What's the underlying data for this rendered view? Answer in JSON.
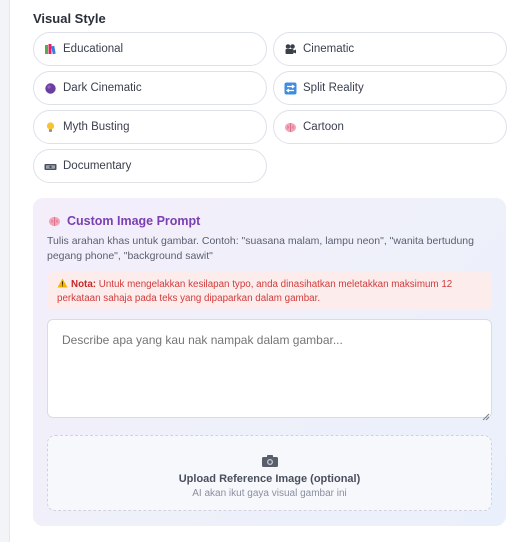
{
  "visual_style": {
    "title": "Visual Style",
    "options": [
      {
        "label": "Educational",
        "icon": "books-icon"
      },
      {
        "label": "Cinematic",
        "icon": "film-camera-icon"
      },
      {
        "label": "Dark Cinematic",
        "icon": "purple-circle-icon"
      },
      {
        "label": "Split Reality",
        "icon": "split-icon"
      },
      {
        "label": "Myth Busting",
        "icon": "lightbulb-icon"
      },
      {
        "label": "Cartoon",
        "icon": "brain-icon"
      },
      {
        "label": "Documentary",
        "icon": "video-camera-icon"
      }
    ]
  },
  "custom_prompt": {
    "title": "Custom Image Prompt",
    "description": "Tulis arahan khas untuk gambar. Contoh: \"suasana malam, lampu neon\", \"wanita bertudung pegang phone\", \"background sawit\"",
    "note_label": "Nota:",
    "note_text": "Untuk mengelakkan kesilapan typo, anda dinasihatkan meletakkan maksimum 12 perkataan sahaja pada teks yang dipaparkan dalam gambar.",
    "textarea_placeholder": "Describe apa yang kau nak nampak dalam gambar...",
    "upload_title": "Upload Reference Image (optional)",
    "upload_subtitle": "AI akan ikut gaya visual gambar ini"
  },
  "colors": {
    "accent_purple": "#7a3fb0",
    "note_red": "#d13b3b",
    "note_bg": "#fdecec"
  }
}
